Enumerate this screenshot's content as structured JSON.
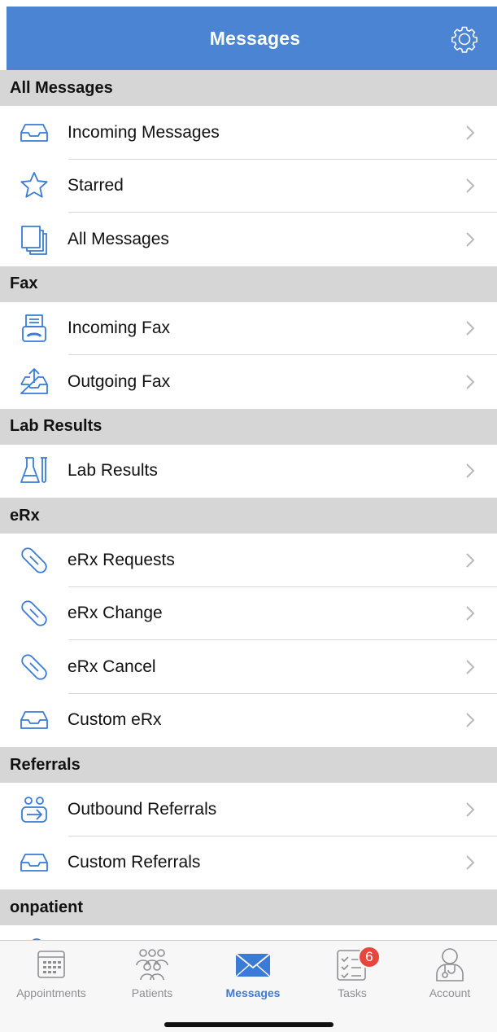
{
  "header": {
    "title": "Messages",
    "settings_icon": "gear-icon"
  },
  "sections": [
    {
      "title": "All Messages",
      "items": [
        {
          "label": "Incoming Messages",
          "icon": "inbox-tray-icon"
        },
        {
          "label": "Starred",
          "icon": "star-icon"
        },
        {
          "label": "All Messages",
          "icon": "stacked-pages-icon"
        }
      ]
    },
    {
      "title": "Fax",
      "items": [
        {
          "label": "Incoming Fax",
          "icon": "fax-machine-icon"
        },
        {
          "label": "Outgoing Fax",
          "icon": "tray-upload-icon"
        }
      ]
    },
    {
      "title": "Lab Results",
      "items": [
        {
          "label": "Lab Results",
          "icon": "flask-test-tube-icon"
        }
      ]
    },
    {
      "title": "eRx",
      "items": [
        {
          "label": "eRx Requests",
          "icon": "pill-icon"
        },
        {
          "label": "eRx Change",
          "icon": "pill-icon"
        },
        {
          "label": "eRx Cancel",
          "icon": "pill-icon"
        },
        {
          "label": "Custom eRx",
          "icon": "inbox-tray-icon"
        }
      ]
    },
    {
      "title": "Referrals",
      "items": [
        {
          "label": "Outbound Referrals",
          "icon": "people-arrow-icon"
        },
        {
          "label": "Custom Referrals",
          "icon": "inbox-tray-icon"
        }
      ]
    },
    {
      "title": "onpatient",
      "items": []
    }
  ],
  "tabs": [
    {
      "label": "Appointments",
      "icon": "calendar-icon",
      "active": false
    },
    {
      "label": "Patients",
      "icon": "people-icon",
      "active": false
    },
    {
      "label": "Messages",
      "icon": "envelope-icon",
      "active": true
    },
    {
      "label": "Tasks",
      "icon": "checklist-icon",
      "active": false,
      "badge": "6"
    },
    {
      "label": "Account",
      "icon": "doctor-icon",
      "active": false
    }
  ],
  "colors": {
    "accent": "#4a84d2",
    "icon_blue": "#3a7bd5",
    "badge": "#e8463c",
    "section_bg": "#d6d6d6"
  }
}
